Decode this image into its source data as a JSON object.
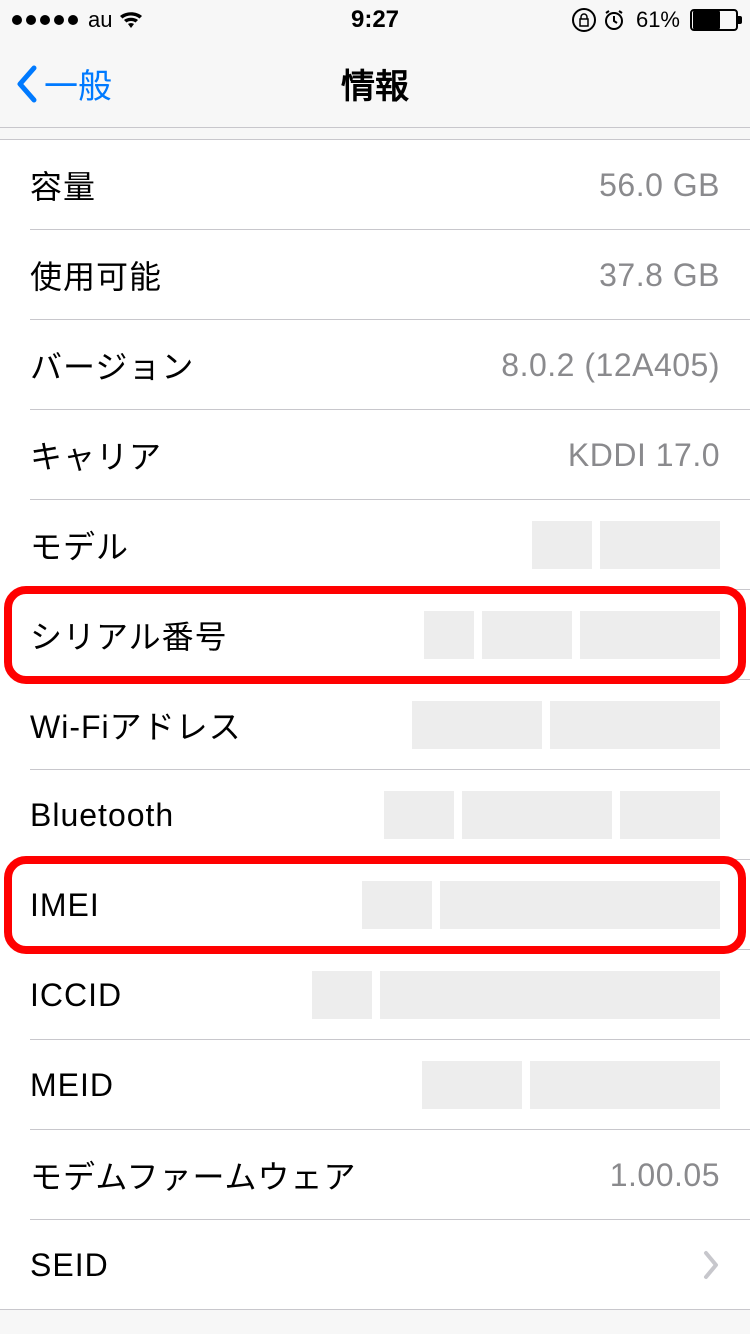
{
  "status": {
    "signal_dots": 5,
    "carrier": "au",
    "time": "9:27",
    "battery_pct": "61%",
    "battery_fill_pct": 61
  },
  "nav": {
    "back_label": "一般",
    "title": "情報"
  },
  "rows": {
    "capacity": {
      "label": "容量",
      "value": "56.0 GB"
    },
    "available": {
      "label": "使用可能",
      "value": "37.8 GB"
    },
    "version": {
      "label": "バージョン",
      "value": "8.0.2 (12A405)"
    },
    "carrier": {
      "label": "キャリア",
      "value": "KDDI 17.0"
    },
    "model": {
      "label": "モデル"
    },
    "serial": {
      "label": "シリアル番号"
    },
    "wifi": {
      "label": "Wi-Fiアドレス"
    },
    "bluetooth": {
      "label": "Bluetooth"
    },
    "imei": {
      "label": "IMEI"
    },
    "iccid": {
      "label": "ICCID"
    },
    "meid": {
      "label": "MEID"
    },
    "modem": {
      "label": "モデムファームウェア",
      "value": "1.00.05"
    },
    "seid": {
      "label": "SEID"
    }
  }
}
